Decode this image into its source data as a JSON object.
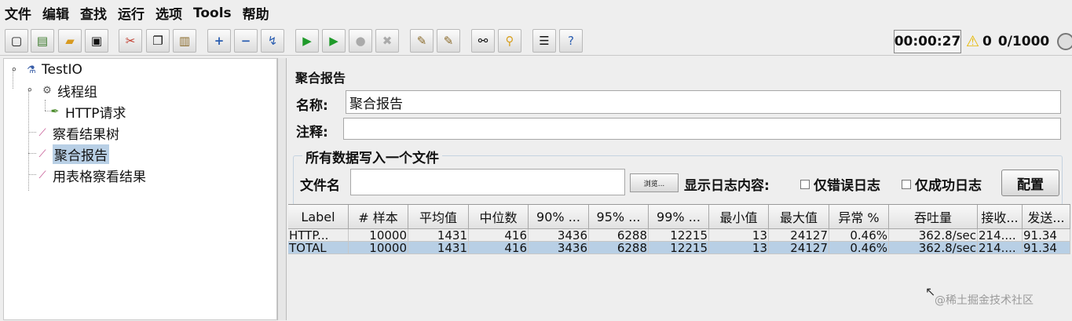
{
  "menu": {
    "items": [
      "文件",
      "编辑",
      "查找",
      "运行",
      "选项",
      "Tools",
      "帮助"
    ]
  },
  "toolbar": {
    "icons": [
      "new-icon",
      "templates-icon",
      "open-icon",
      "save-icon",
      "cut-icon",
      "copy-icon",
      "paste-icon",
      "expand-icon",
      "collapse-icon",
      "toggle-icon",
      "start-icon",
      "start-no-timers-icon",
      "stop-icon",
      "shutdown-icon",
      "clear-icon",
      "clear-all-icon",
      "search-icon",
      "reset-search-icon",
      "function-helper-icon",
      "help-icon"
    ],
    "timer": "00:00:27",
    "warning_count": "0",
    "threads": "0/1000"
  },
  "tree": {
    "root": "TestIO",
    "thread_group": "线程组",
    "http_request": "HTTP请求",
    "view_results_tree": "察看结果树",
    "aggregate_report": "聚合报告",
    "view_results_table": "用表格察看结果"
  },
  "panel": {
    "title": "聚合报告",
    "name_label": "名称:",
    "name_value": "聚合报告",
    "comment_label": "注释:",
    "comment_value": "",
    "group_title": "所有数据写入一个文件",
    "filename_label": "文件名",
    "filename_value": "",
    "browse_label": "浏览...",
    "log_label": "显示日志内容:",
    "errors_only_label": "仅错误日志",
    "success_only_label": "仅成功日志",
    "config_label": "配置"
  },
  "table": {
    "columns": [
      "Label",
      "# 样本",
      "平均值",
      "中位数",
      "90% ...",
      "95% ...",
      "99% ...",
      "最小值",
      "最大值",
      "异常 %",
      "吞吐量",
      "接收...",
      "发送..."
    ],
    "rows": [
      [
        "HTTP...",
        "10000",
        "1431",
        "416",
        "3436",
        "6288",
        "12215",
        "13",
        "24127",
        "0.46%",
        "362.8/sec",
        "214....",
        "91.34"
      ],
      [
        "TOTAL",
        "10000",
        "1431",
        "416",
        "3436",
        "6288",
        "12215",
        "13",
        "24127",
        "0.46%",
        "362.8/sec",
        "214....",
        "91.34"
      ]
    ]
  },
  "watermark": "@稀土掘金技术社区"
}
